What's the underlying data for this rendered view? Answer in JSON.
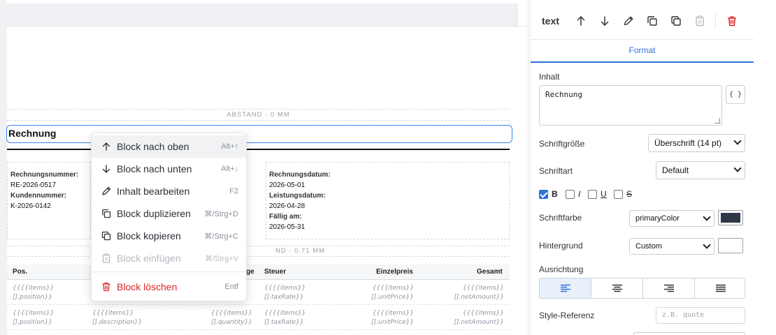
{
  "canvas": {
    "spacer_top": "ABSTAND · 0 MM",
    "spacer_mid": "ND · 0.71 MM",
    "title": "Rechnung",
    "info_left": [
      {
        "label": "Rechnungsnummer:",
        "value": "RE-2026-0517"
      },
      {
        "label": "Kundennummer:",
        "value": "K-2026-0142"
      }
    ],
    "info_right": [
      {
        "label": "Rechnungsdatum:",
        "value": "2026-05-01"
      },
      {
        "label": "Leistungsdatum:",
        "value": "2026-04-28"
      },
      {
        "label": "Fällig am:",
        "value": "2026-05-31"
      }
    ],
    "table": {
      "headers": {
        "pos": "Pos.",
        "qty": "ge",
        "tax": "Steuer",
        "unit": "Einzelpreis",
        "total": "Gesamt"
      },
      "rows": [
        {
          "pos": [
            "{{{{items}}",
            "[].position}}"
          ],
          "desc": [
            "",
            ""
          ],
          "qty": [
            "",
            ""
          ],
          "tax": [
            "{{{{items}}",
            "[].taxRate}}"
          ],
          "unit": [
            "{{{{items}}",
            "[].unitPrice}}"
          ],
          "total": [
            "{{{{items}}",
            "[].netAmount}}"
          ]
        },
        {
          "pos": [
            "{{{{items}}",
            "[].position}}"
          ],
          "desc": [
            "{{{{items}}",
            "[].description}}"
          ],
          "qty": [
            "{{{{items}}",
            "[].quantity}}"
          ],
          "tax": [
            "{{{{items}}",
            "[].taxRate}}"
          ],
          "unit": [
            "{{{{items}}",
            "[].unitPrice}}"
          ],
          "total": [
            "{{{{items}}",
            "[].netAmount}}"
          ]
        }
      ]
    }
  },
  "context_menu": {
    "items": [
      {
        "label": "Block nach oben",
        "shortcut": "Alt+↑"
      },
      {
        "label": "Block nach unten",
        "shortcut": "Alt+↓"
      },
      {
        "label": "Inhalt bearbeiten",
        "shortcut": "F2"
      },
      {
        "label": "Block duplizieren",
        "shortcut": "⌘/Strg+D"
      },
      {
        "label": "Block kopieren",
        "shortcut": "⌘/Strg+C"
      },
      {
        "label": "Block einfügen",
        "shortcut": "⌘/Strg+V"
      },
      {
        "label": "Block löschen",
        "shortcut": "Entf"
      }
    ]
  },
  "panel": {
    "block_type": "text",
    "tab": "Format",
    "content_label": "Inhalt",
    "content_value": "Rechnung",
    "var_button": "{ }",
    "font_size_label": "Schriftgröße",
    "font_size_value": "Überschrift (14 pt)",
    "font_label": "Schriftart",
    "font_value": "Default",
    "styles": {
      "bold": "B",
      "italic": "I",
      "underline": "U",
      "strike": "S"
    },
    "color_label": "Schriftfarbe",
    "color_value": "primaryColor",
    "color_swatch": "#2d3748",
    "bg_label": "Hintergrund",
    "bg_value": "Custom",
    "bg_swatch": "#ffffff",
    "align_label": "Ausrichtung",
    "style_ref_label": "Style-Referenz",
    "style_ref_placeholder": "z.B. quote"
  },
  "colors": {
    "accent": "#2f73d9",
    "danger": "#dc2626",
    "selection": "#3b82f6"
  }
}
